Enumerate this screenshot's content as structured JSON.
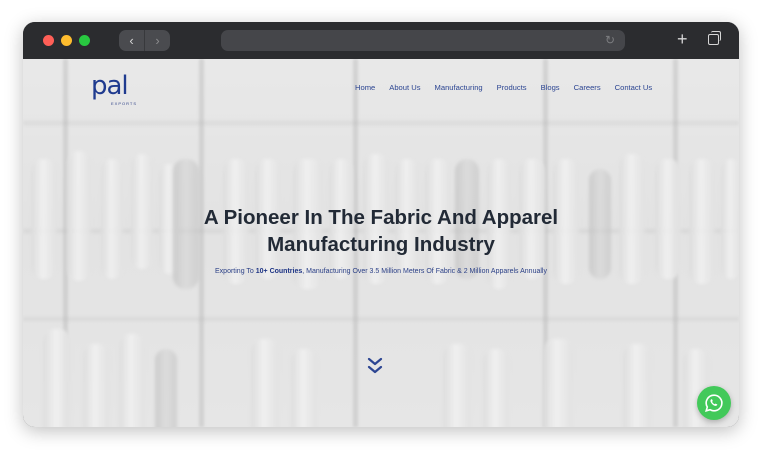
{
  "browser": {
    "back_label": "‹",
    "forward_label": "›",
    "reload_label": "↻",
    "new_tab_label": "+"
  },
  "site": {
    "logo_text": "pal",
    "logo_subtext": "EXPORTS",
    "brand_color": "#1f3b8f"
  },
  "nav": {
    "items": [
      "Home",
      "About Us",
      "Manufacturing",
      "Products",
      "Blogs",
      "Careers",
      "Contact Us"
    ]
  },
  "hero": {
    "title_line1": "A Pioneer In The Fabric And Apparel",
    "title_line2": "Manufacturing Industry",
    "subtitle_prefix": "Exporting To ",
    "subtitle_bold": "10+ Countries",
    "subtitle_suffix": ", Manufacturing Over 3.5 Million Meters Of Fabric & 2 Million Apparels Annually"
  },
  "icons": {
    "scroll": "chevron-double-down-icon",
    "chat": "whatsapp-icon"
  },
  "colors": {
    "whatsapp": "#42c95a",
    "title": "#222a36"
  }
}
